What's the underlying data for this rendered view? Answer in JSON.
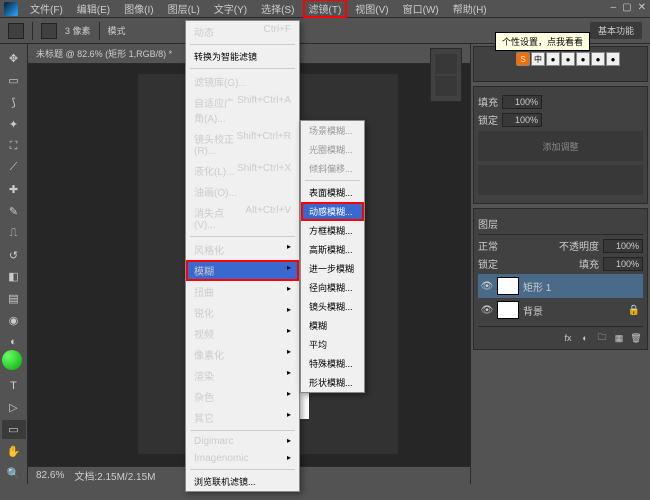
{
  "menubar": {
    "items": [
      {
        "label": "文件(F)"
      },
      {
        "label": "编辑(E)"
      },
      {
        "label": "图像(I)"
      },
      {
        "label": "图层(L)"
      },
      {
        "label": "文字(Y)"
      },
      {
        "label": "选择(S)"
      },
      {
        "label": "滤镜(T)",
        "hl": true
      },
      {
        "label": "视图(V)"
      },
      {
        "label": "窗口(W)"
      },
      {
        "label": "帮助(H)"
      }
    ]
  },
  "optionbar": {
    "brush_label": "3 像素",
    "mode_label": "模式",
    "right_pill": "基本功能"
  },
  "doc_tab": "未标题 @ 82.6% (矩形 1,RGB/8) *",
  "statusbar": {
    "zoom": "82.6%",
    "info": "文档:2.15M/2.15M"
  },
  "filter_menu": {
    "last": {
      "label": "动态",
      "shortcut": "Ctrl+F"
    },
    "convert": "转换为智能滤镜",
    "group1": [
      {
        "label": "滤镜库(G)..."
      },
      {
        "label": "自适应广角(A)...",
        "shortcut": "Shift+Ctrl+A"
      },
      {
        "label": "镜头校正(R)...",
        "shortcut": "Shift+Ctrl+R"
      },
      {
        "label": "液化(L)...",
        "shortcut": "Shift+Ctrl+X"
      },
      {
        "label": "油画(O)..."
      },
      {
        "label": "消失点(V)...",
        "shortcut": "Alt+Ctrl+V"
      }
    ],
    "group2": [
      {
        "label": "风格化"
      },
      {
        "label": "模糊",
        "sel": true
      },
      {
        "label": "扭曲"
      },
      {
        "label": "锐化"
      },
      {
        "label": "视频"
      },
      {
        "label": "像素化"
      },
      {
        "label": "渲染"
      },
      {
        "label": "杂色"
      },
      {
        "label": "其它"
      }
    ],
    "group3": [
      {
        "label": "Digimarc"
      },
      {
        "label": "Imagenomic"
      }
    ],
    "browse": "浏览联机滤镜..."
  },
  "blur_submenu": {
    "items1": [
      {
        "label": "场景模糊..."
      },
      {
        "label": "光圈模糊..."
      },
      {
        "label": "倾斜偏移..."
      }
    ],
    "items2": [
      {
        "label": "表面模糊..."
      },
      {
        "label": "动感模糊...",
        "sel": true
      },
      {
        "label": "方框模糊..."
      },
      {
        "label": "高斯模糊..."
      },
      {
        "label": "进一步模糊"
      },
      {
        "label": "径向模糊..."
      },
      {
        "label": "镜头模糊..."
      },
      {
        "label": "模糊"
      },
      {
        "label": "平均"
      },
      {
        "label": "特殊模糊..."
      },
      {
        "label": "形状模糊..."
      }
    ]
  },
  "panels": {
    "tooltip": "个性设置，点我看看",
    "adjust": {
      "lbl1": "填充",
      "val1": "100%",
      "lbl2": "锁定",
      "val2": "100%"
    },
    "placeholder": "添加调整",
    "layers": {
      "tab": "图层",
      "blend": "正常",
      "opacity_lbl": "不透明度",
      "opacity": "100%",
      "lock_lbl": "锁定",
      "fill_lbl": "填充",
      "fill": "100%",
      "layer1": "矩形 1",
      "bg": "背景"
    }
  },
  "sogou": {
    "chars": [
      "中",
      "●",
      "●",
      "●",
      "●",
      "●"
    ]
  }
}
